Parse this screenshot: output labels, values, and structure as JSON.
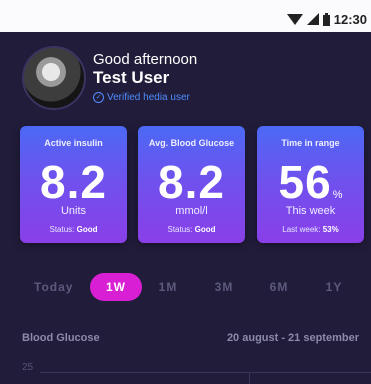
{
  "status_bar": {
    "time": "12:30"
  },
  "header": {
    "greeting": "Good afternoon",
    "name": "Test User",
    "verified_label": "Verified hedia user"
  },
  "cards": [
    {
      "title": "Active insulin",
      "value": "8.2",
      "unit": "Units",
      "status_label": "Status:",
      "status_value": "Good"
    },
    {
      "title": "Avg. Blood Glucose",
      "value": "8.2",
      "unit": "mmol/l",
      "status_label": "Status:",
      "status_value": "Good"
    },
    {
      "title": "Time in range",
      "value": "56",
      "value_suffix": "%",
      "unit": "This week",
      "status_label": "Last week:",
      "status_value": "53%"
    }
  ],
  "ranges": [
    "Today",
    "1W",
    "1M",
    "3M",
    "6M",
    "1Y"
  ],
  "selected_range": "1W",
  "blood_glucose": {
    "title": "Blood Glucose",
    "date_range": "20 august - 21 september",
    "y_tick": "25"
  },
  "colors": {
    "background": "#211c3a",
    "card_gradient_start": "#4b69f5",
    "card_gradient_end": "#8a3fe8",
    "active_range": "#d81fd4",
    "verified": "#4f8dff"
  }
}
